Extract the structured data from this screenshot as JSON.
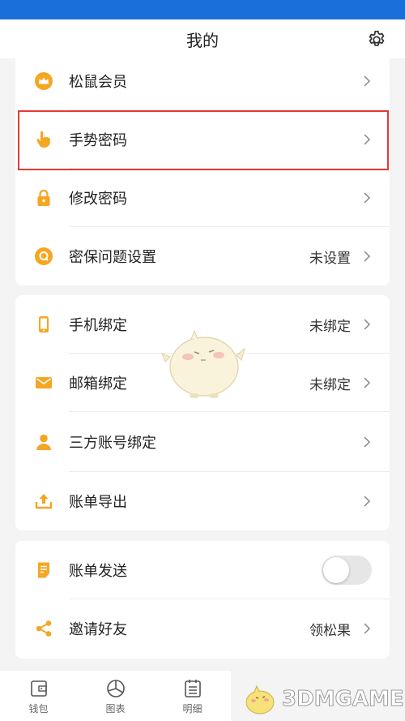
{
  "header": {
    "title": "我的"
  },
  "section1": {
    "items": [
      {
        "label": "松鼠会员",
        "value": "",
        "icon": "crown-icon"
      },
      {
        "label": "手势密码",
        "value": "",
        "icon": "hand-pointer-icon"
      },
      {
        "label": "修改密码",
        "value": "",
        "icon": "lock-icon"
      },
      {
        "label": "密保问题设置",
        "value": "未设置",
        "icon": "question-q-icon"
      }
    ]
  },
  "section2": {
    "items": [
      {
        "label": "手机绑定",
        "value": "未绑定",
        "icon": "phone-icon"
      },
      {
        "label": "邮箱绑定",
        "value": "未绑定",
        "icon": "mail-icon"
      },
      {
        "label": "三方账号绑定",
        "value": "",
        "icon": "user-icon"
      },
      {
        "label": "账单导出",
        "value": "",
        "icon": "upload-icon"
      }
    ]
  },
  "section3": {
    "items": [
      {
        "label": "账单发送",
        "toggle_on": false,
        "icon": "bill-icon"
      },
      {
        "label": "邀请好友",
        "value": "领松果",
        "icon": "share-icon"
      }
    ]
  },
  "tabbar": {
    "tabs": [
      {
        "label": "钱包",
        "icon": "wallet-icon"
      },
      {
        "label": "图表",
        "icon": "pie-chart-icon"
      },
      {
        "label": "明细",
        "icon": "list-icon"
      }
    ]
  },
  "watermark": {
    "text": "3DMGAME"
  },
  "colors": {
    "accent": "#f5a623",
    "highlight": "#e53935",
    "status_bar": "#1a6fd8"
  }
}
